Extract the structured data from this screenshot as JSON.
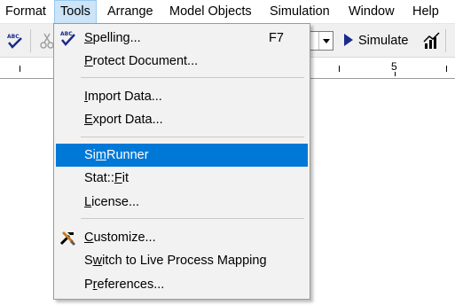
{
  "menubar": {
    "items": [
      "Format",
      "Tools",
      "Arrange",
      "Model Objects",
      "Simulation",
      "Window",
      "Help"
    ]
  },
  "toolbar": {
    "simulate_label": "Simulate"
  },
  "ruler": {
    "label": "5"
  },
  "tools_menu": {
    "spelling": {
      "pre": "",
      "u": "S",
      "post": "pelling...",
      "shortcut": "F7"
    },
    "protect_document": {
      "pre": "",
      "u": "P",
      "post": "rotect Document..."
    },
    "import_data": {
      "pre": "",
      "u": "I",
      "post": "mport Data..."
    },
    "export_data": {
      "pre": "",
      "u": "E",
      "post": "xport Data..."
    },
    "simrunner": {
      "pre": "Si",
      "u": "m",
      "post": "Runner"
    },
    "statfit": {
      "pre": "Stat::",
      "u": "F",
      "post": "it"
    },
    "license": {
      "pre": "",
      "u": "L",
      "post": "icense..."
    },
    "customize": {
      "pre": "",
      "u": "C",
      "post": "ustomize..."
    },
    "live_process": {
      "pre": "S",
      "u": "w",
      "post": "itch to Live Process Mapping"
    },
    "preferences": {
      "pre": "P",
      "u": "r",
      "post": "eferences..."
    }
  },
  "colors": {
    "highlight": "#0078d7",
    "open_menu": "#cce4f7"
  }
}
